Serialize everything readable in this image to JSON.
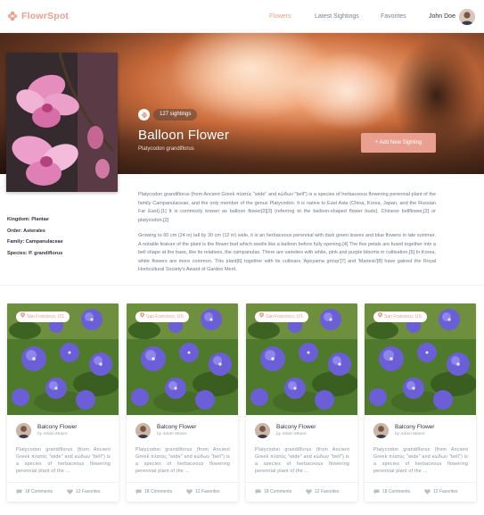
{
  "header": {
    "logo": "FlowrSpot",
    "nav": [
      "Flowers",
      "Latest Sightings",
      "Favorites"
    ],
    "user": "John Doe"
  },
  "hero": {
    "sightings": "127 sightings",
    "title": "Balloon Flower",
    "subtitle": "Platycodon grandiflorus",
    "add_button": "+ Add New Sighting"
  },
  "taxonomy": [
    "Kingdom: Plantae",
    "Order: Asterales",
    "Family: Campanulaceae",
    "Species: P. grandiflorus"
  ],
  "description": {
    "p1": "Platycodon grandiflorus (from Ancient Greek πλατύς \"wide\" and κώδων \"bell\") is a species of herbaceous flowering perennial plant of the family Campanulaceae, and the only member of the genus Platycodon. It is native to East Asia (China, Korea, Japan, and the Russian Far East).[1] It is commonly known as balloon flower[2][3] (referring to the balloon-shaped flower buds), Chinese bellflower,[2] or platycodon.[2]",
    "p2": "Growing to 60 cm (24 in) tall by 30 cm (12 in) wide, it is an herbaceous perennial with dark green leaves and blue flowers in late summer. A notable feature of the plant is the flower bud which swells like a balloon before fully opening.[4] The five petals are fused together into a bell shape at the base, like its relatives, the campanulas. There are varieties with white, pink and purple blooms in cultivation.[5] In Korea, white flowers are more common. This plant[6] together with its cultivars 'Apoyama group'[7] and 'Mariesii'[8] have gained the Royal Horticultural Society's Award of Garden Merit."
  },
  "cards": [
    {
      "location": "San Francisco, US",
      "name": "Balcony Flower",
      "author": "by Adam Moore",
      "text": "Platycodon grandiflorus (from Ancient Greek πλατύς \"wide\" and κώδων \"bell\") is a species of herbaceous flowering perennial plant of the ...",
      "comments": "18 Comments",
      "favorites": "12 Favorites"
    },
    {
      "location": "San Francisco, US",
      "name": "Balcony Flower",
      "author": "by Adam Moore",
      "text": "Platycodon grandiflorus (from Ancient Greek πλατύς \"wide\" and κώδων \"bell\") is a species of herbaceous flowering perennial plant of the ...",
      "comments": "18 Comments",
      "favorites": "12 Favorites"
    },
    {
      "location": "San Francisco, US",
      "name": "Balcony Flower",
      "author": "by Adam Moore",
      "text": "Platycodon grandiflorus (from Ancient Greek πλατύς \"wide\" and κώδων \"bell\") is a species of herbaceous flowering perennial plant of the ...",
      "comments": "18 Comments",
      "favorites": "12 Favorites"
    },
    {
      "location": "San Francisco, US",
      "name": "Balcony Flower",
      "author": "by Adam Moore",
      "text": "Platycodon grandiflorus (from Ancient Greek πλατύς \"wide\" and κώδων \"bell\") is a species of herbaceous flowering perennial plant of the ...",
      "comments": "18 Comments",
      "favorites": "12 Favorites"
    }
  ],
  "colors": {
    "accent": "#e9a18e",
    "flower_purple": "#6a5fd6",
    "leaf_green": "#4f7a2c"
  },
  "icons": [
    "flower-logo-icon",
    "sighting-icon",
    "location-pin-icon",
    "comment-icon",
    "heart-icon"
  ]
}
